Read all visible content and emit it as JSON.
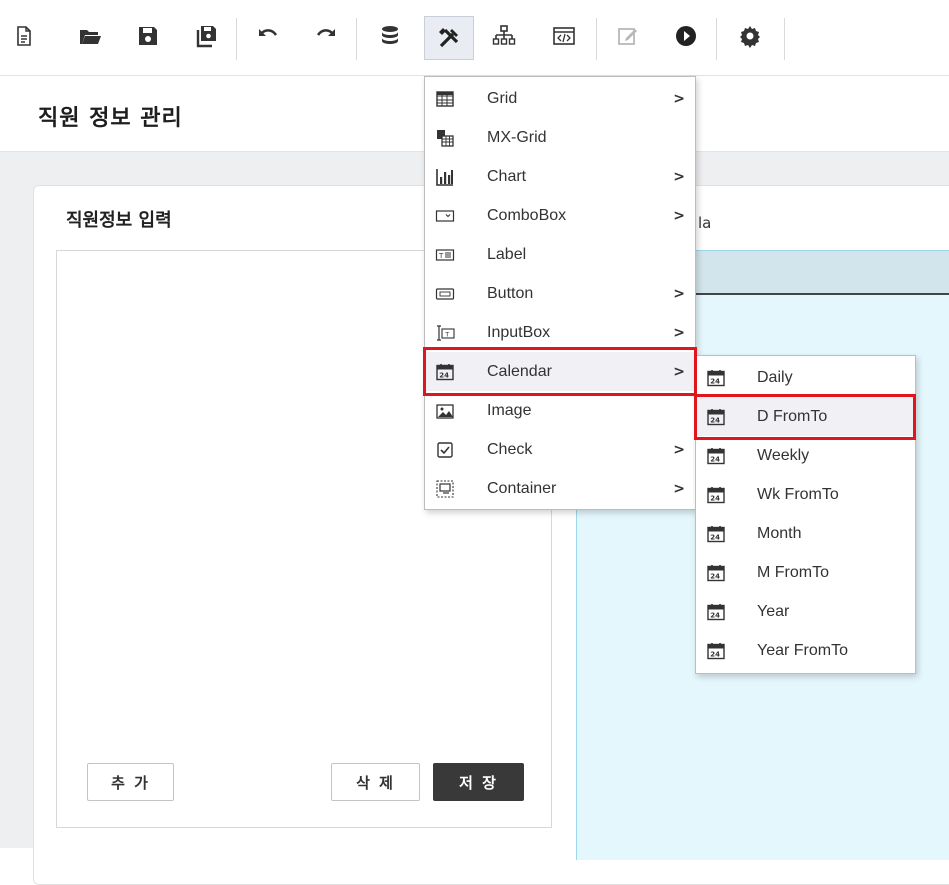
{
  "toolbar": {
    "buttons": [
      {
        "icon": "new-file-icon"
      },
      {
        "icon": "open-folder-icon"
      },
      {
        "icon": "save-icon"
      },
      {
        "icon": "save-all-icon"
      },
      {
        "icon": "undo-icon"
      },
      {
        "icon": "redo-icon"
      },
      {
        "icon": "database-icon"
      },
      {
        "icon": "tools-icon",
        "active": true
      },
      {
        "icon": "hierarchy-icon"
      },
      {
        "icon": "code-icon"
      },
      {
        "icon": "edit-icon",
        "disabled": true
      },
      {
        "icon": "play-icon"
      },
      {
        "icon": "gear-icon"
      }
    ]
  },
  "page": {
    "title": "직원 정보 관리",
    "section_title": "직원정보 입력",
    "right_label": "la"
  },
  "buttons": {
    "add": "추 가",
    "delete": "삭 제",
    "save": "저 장"
  },
  "main_menu": {
    "items": [
      {
        "label": "Grid",
        "icon": "grid-icon",
        "submenu": true
      },
      {
        "label": "MX-Grid",
        "icon": "mx-grid-icon",
        "submenu": false
      },
      {
        "label": "Chart",
        "icon": "chart-icon",
        "submenu": true
      },
      {
        "label": "ComboBox",
        "icon": "combobox-icon",
        "submenu": true
      },
      {
        "label": "Label",
        "icon": "label-icon",
        "submenu": false
      },
      {
        "label": "Button",
        "icon": "button-icon",
        "submenu": true
      },
      {
        "label": "InputBox",
        "icon": "inputbox-icon",
        "submenu": true
      },
      {
        "label": "Calendar",
        "icon": "calendar-icon",
        "submenu": true,
        "highlighted": true
      },
      {
        "label": "Image",
        "icon": "image-icon",
        "submenu": false
      },
      {
        "label": "Check",
        "icon": "check-icon",
        "submenu": true
      },
      {
        "label": "Container",
        "icon": "container-icon",
        "submenu": true
      }
    ],
    "arrow": ">"
  },
  "calendar_submenu": {
    "items": [
      {
        "label": "Daily",
        "icon": "calendar-icon"
      },
      {
        "label": "D FromTo",
        "icon": "calendar-icon",
        "highlighted": true
      },
      {
        "label": "Weekly",
        "icon": "calendar-icon"
      },
      {
        "label": "Wk FromTo",
        "icon": "calendar-icon"
      },
      {
        "label": "Month",
        "icon": "calendar-icon"
      },
      {
        "label": "M FromTo",
        "icon": "calendar-icon"
      },
      {
        "label": "Year",
        "icon": "calendar-icon"
      },
      {
        "label": "Year FromTo",
        "icon": "calendar-icon"
      }
    ],
    "calendar_glyph": "24"
  },
  "colors": {
    "highlight": "#e0151e",
    "grid_bg": "#e4f7fd",
    "grid_header": "#d2e5ec",
    "dark_button": "#393939"
  }
}
